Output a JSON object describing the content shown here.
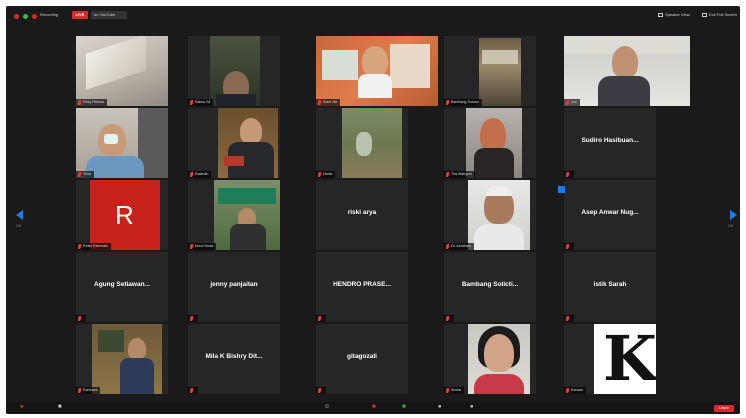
{
  "topbar": {
    "recording_label": "Recording",
    "live_label": "LIVE",
    "live_on_label": "on YouTube",
    "speaker_view_label": "Speaker View",
    "exit_full_screen_label": "Exit Full Screen"
  },
  "pagination": {
    "left_label": "1/3",
    "right_label": "1/3"
  },
  "tiles": [
    {
      "name": "Reky Fitriana",
      "type": "video"
    },
    {
      "name": "Sabus Sil",
      "type": "video"
    },
    {
      "name": "Slam Sie",
      "type": "video"
    },
    {
      "name": "Bambang Suroso",
      "type": "video"
    },
    {
      "name": "Jun",
      "type": "video"
    },
    {
      "name": "Yulia",
      "type": "video"
    },
    {
      "name": "Ratimah",
      "type": "video"
    },
    {
      "name": "Herlia",
      "type": "video"
    },
    {
      "name": "Tira Wahyuni",
      "type": "video"
    },
    {
      "name": "Sudiro Hasibuan...",
      "type": "name"
    },
    {
      "name": "Reski Rammah",
      "type": "video",
      "letter": "R"
    },
    {
      "name": "Nurul Huda",
      "type": "video"
    },
    {
      "name": "riski arya",
      "type": "name"
    },
    {
      "name": "Dr. Abraham",
      "type": "video"
    },
    {
      "name": "Asep Anwar Nug...",
      "type": "name"
    },
    {
      "name": "Agung Setiawan...",
      "type": "name"
    },
    {
      "name": "jenny panjaitan",
      "type": "name"
    },
    {
      "name": "HENDRO PRASE...",
      "type": "name"
    },
    {
      "name": "Bambang Solicti...",
      "type": "name"
    },
    {
      "name": "istik Sarah",
      "type": "name"
    },
    {
      "name": "Rahmani",
      "type": "video"
    },
    {
      "name": "Mila K Bishry Dit...",
      "type": "name"
    },
    {
      "name": "gitagozali",
      "type": "name"
    },
    {
      "name": "Sindar",
      "type": "video"
    },
    {
      "name": "Kanaan",
      "type": "video",
      "letter": "K"
    }
  ],
  "toolbar": {
    "end_label": "Leave"
  },
  "colors": {
    "background": "#1a1a1a",
    "live": "#d72a2a",
    "accent": "#1d7cf2",
    "mic_off": "#e43a3a"
  }
}
